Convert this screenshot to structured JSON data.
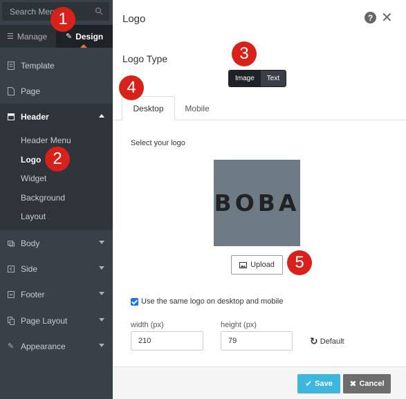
{
  "sidebar": {
    "search_placeholder": "Search Menu",
    "modes": {
      "manage": "Manage",
      "design": "Design"
    },
    "items": {
      "template": "Template",
      "page": "Page",
      "header": "Header",
      "body": "Body",
      "side": "Side",
      "footer": "Footer",
      "page_layout": "Page Layout",
      "appearance": "Appearance"
    },
    "header_sub": [
      "Header Menu",
      "Logo",
      "Widget",
      "Background",
      "Layout"
    ]
  },
  "main": {
    "title": "Logo",
    "logo_type_label": "Logo Type",
    "logo_type_options": [
      "Image",
      "Text"
    ],
    "tabs": [
      "Desktop",
      "Mobile"
    ],
    "select_label": "Select your logo",
    "preview_text": "BOBA",
    "upload_label": "Upload",
    "same_logo_label": "Use the same logo on desktop and mobile",
    "width_label": "width (px)",
    "width_value": "210",
    "height_label": "height (px)",
    "height_value": "79",
    "default_label": "Default",
    "save_label": "Save",
    "cancel_label": "Cancel"
  },
  "annotations": [
    "1",
    "2",
    "3",
    "4",
    "5"
  ],
  "colors": {
    "accent_orange": "#e07b2f",
    "badge_red": "#d9211c",
    "save_blue": "#3db7de"
  }
}
